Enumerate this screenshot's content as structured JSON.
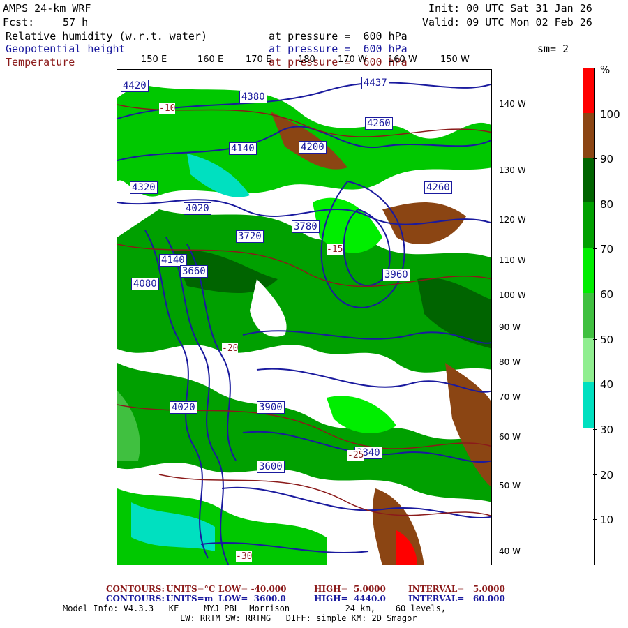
{
  "header": {
    "model": "AMPS 24-km WRF",
    "init": "Init: 00 UTC Sat 31 Jan 26",
    "fcst_label": "Fcst:",
    "fcst_value": "57 h",
    "valid": "Valid: 09 UTC Mon 02 Feb 26"
  },
  "fields": [
    {
      "name": "Relative humidity (w.r.t. water)",
      "level": "at pressure =  600 hPa",
      "color": "#000000"
    },
    {
      "name": "Geopotential height",
      "level": "at pressure =  600 hPa",
      "color": "#1a1a9e"
    },
    {
      "name": "Temperature",
      "level": "at pressure =  600 hPa",
      "color": "#8b1a1a"
    }
  ],
  "smoothing": "sm= 2",
  "map": {
    "lon_labels": [
      "150 E",
      "160 E",
      "170 E",
      "180",
      "170 W",
      "160 W",
      "150 W"
    ],
    "lat_labels": [
      "140 W",
      "130 W",
      "120 W",
      "110 W",
      "100 W",
      "90 W",
      "80 W",
      "70 W",
      "60 W",
      "50 W",
      "40 W"
    ],
    "height_labels": [
      "4420",
      "4380",
      "4260",
      "4200",
      "4140",
      "4320",
      "4020",
      "4260",
      "4140",
      "4080",
      "4020",
      "3960",
      "3900",
      "3840",
      "3780",
      "3720",
      "3660",
      "3600",
      "4437"
    ],
    "temp_labels": [
      "-10",
      "-15",
      "-20",
      "-25",
      "-30"
    ]
  },
  "colorbar": {
    "unit": "%",
    "labels": [
      "100",
      "90",
      "80",
      "70",
      "60",
      "50",
      "40",
      "30",
      "20",
      "10"
    ],
    "colors": [
      "#ff0000",
      "#8b4513",
      "#006400",
      "#00a000",
      "#00ee00",
      "#40c040",
      "#90ee90",
      "#00e0c0",
      "#ffffff",
      "#ffffff"
    ]
  },
  "footer": {
    "line1": {
      "label": "CONTOURS:",
      "units": "UNITS=°C",
      "low": "LOW= -40.000",
      "high": "HIGH=  5.0000",
      "interval": "INTERVAL=   5.0000",
      "color": "#8b1a1a"
    },
    "line2": {
      "label": "CONTOURS:",
      "units": "UNITS=m",
      "low": "LOW=  3600.0",
      "high": "HIGH=  4440.0",
      "interval": "INTERVAL=   60.000",
      "color": "#1a1a9e"
    },
    "line3": "Model Info: V4.3.3   KF     MYJ PBL  Morrison           24 km,    60 levels,",
    "line4": "LW: RRTM SW: RRTMG   DIFF: simple KM: 2D Smagor"
  }
}
